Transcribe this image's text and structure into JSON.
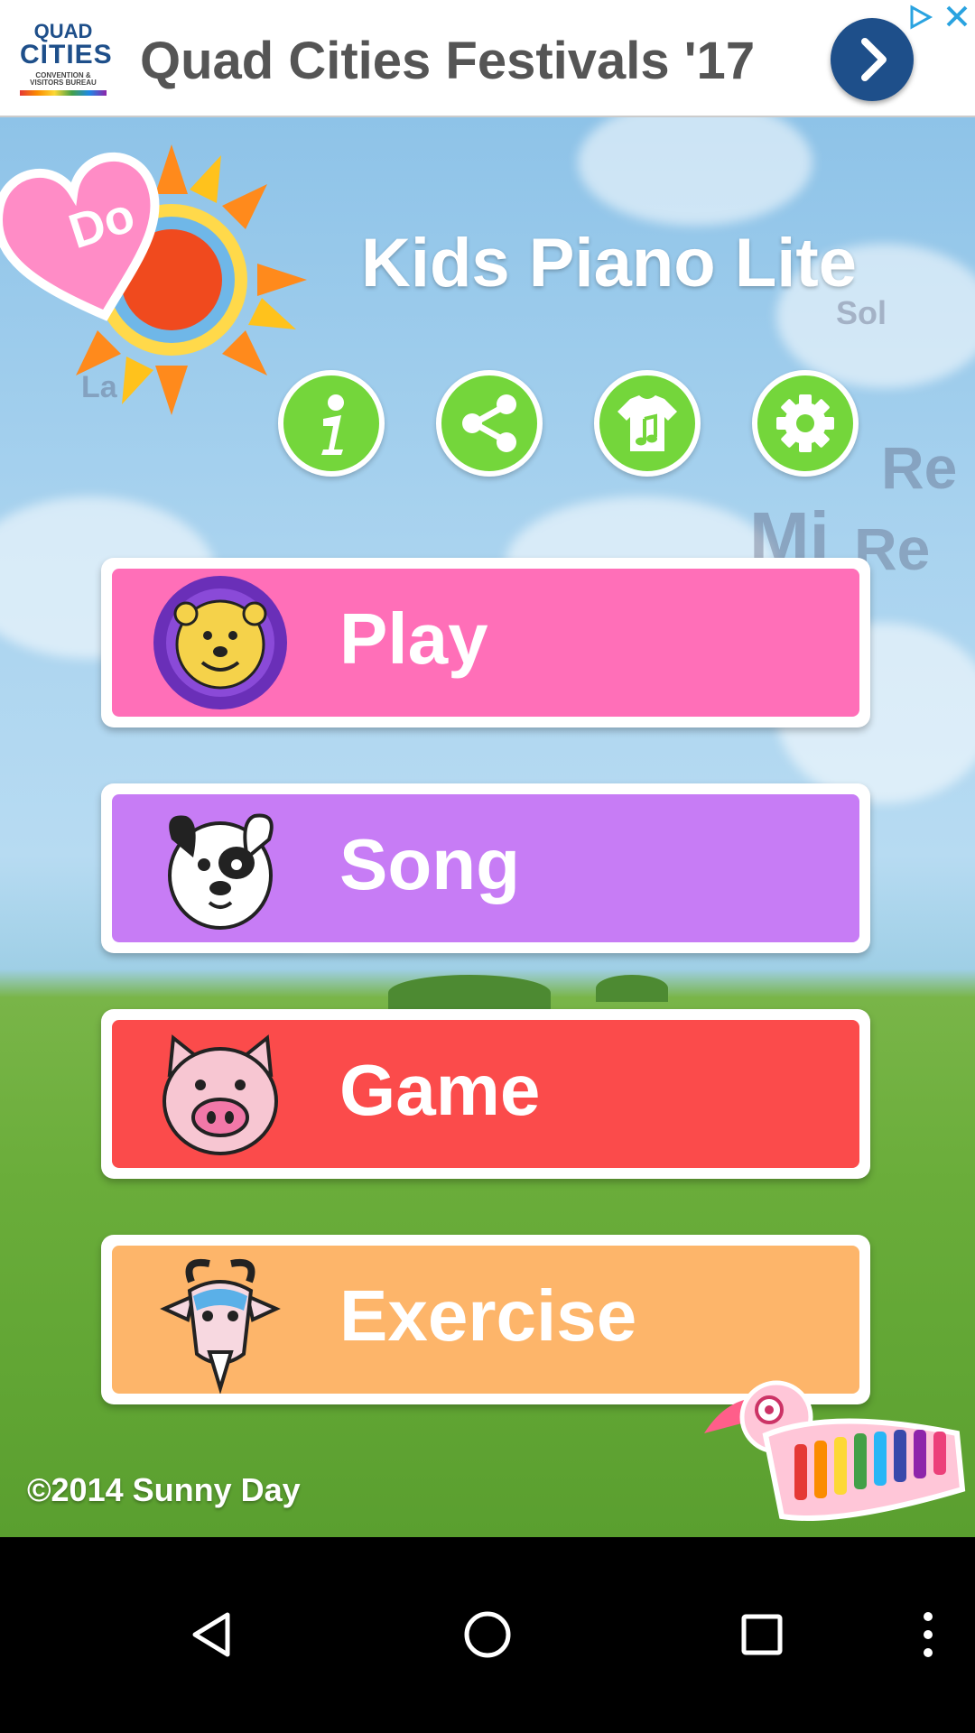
{
  "ad": {
    "logo_line1": "QUAD",
    "logo_line2": "CITIES",
    "logo_line3": "CONVENTION & VISITORS BUREAU",
    "title": "Quad Cities Festivals '17",
    "go_icon": "chevron-right-icon",
    "choices_icon": "ad-choices-icon",
    "close_icon": "close-icon",
    "accent_color": "#1e4f8a"
  },
  "app": {
    "title": "Kids Piano Lite",
    "heart_label": "Do",
    "background_notes": [
      "La",
      "Sol",
      "Re",
      "Mi",
      "Re"
    ],
    "icon_buttons": [
      {
        "name": "info",
        "icon": "info-icon"
      },
      {
        "name": "share",
        "icon": "share-icon"
      },
      {
        "name": "shirt",
        "icon": "shirt-music-icon"
      },
      {
        "name": "settings",
        "icon": "gear-icon"
      }
    ],
    "icon_button_color": "#74d63b",
    "menu": [
      {
        "label": "Play",
        "animal": "lion-icon",
        "color": "#ff6fb8"
      },
      {
        "label": "Song",
        "animal": "dog-icon",
        "color": "#c77cf5"
      },
      {
        "label": "Game",
        "animal": "pig-icon",
        "color": "#fb4b4b"
      },
      {
        "label": "Exercise",
        "animal": "goat-icon",
        "color": "#fdb56a"
      }
    ],
    "copyright": "©2014 Sunny Day"
  },
  "navbar": {
    "back_icon": "back-triangle-icon",
    "home_icon": "home-circle-icon",
    "recents_icon": "recents-square-icon",
    "menu_icon": "more-vertical-icon"
  }
}
